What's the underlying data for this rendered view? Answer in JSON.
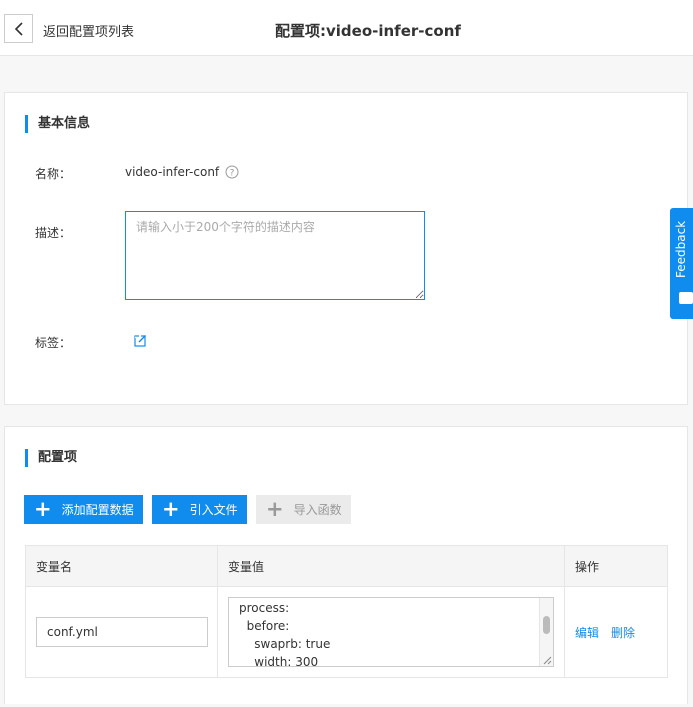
{
  "header": {
    "back_label": "返回配置项列表",
    "title": "配置项:video-infer-conf"
  },
  "basic_info": {
    "section_title": "基本信息",
    "name_label": "名称：",
    "name_value": "video-infer-conf",
    "desc_label": "描述：",
    "desc_placeholder": "请输入小于200个字符的描述内容",
    "desc_value": "",
    "tags_label": "标签："
  },
  "config": {
    "section_title": "配置项",
    "buttons": {
      "add_data": "添加配置数据",
      "import_file": "引入文件",
      "import_function": "导入函数"
    },
    "table": {
      "headers": [
        "变量名",
        "变量值",
        "操作"
      ],
      "rows": [
        {
          "name": "conf.yml",
          "value_lines": [
            "process:",
            "  before:",
            "    swaprb: true",
            "    width: 300"
          ],
          "actions": [
            "编辑",
            "删除"
          ]
        }
      ]
    }
  },
  "feedback": {
    "label": "Feedback"
  },
  "colors": {
    "accent": "#108cee",
    "disabled_bg": "#ebebeb",
    "border": "#e6e6e6"
  }
}
